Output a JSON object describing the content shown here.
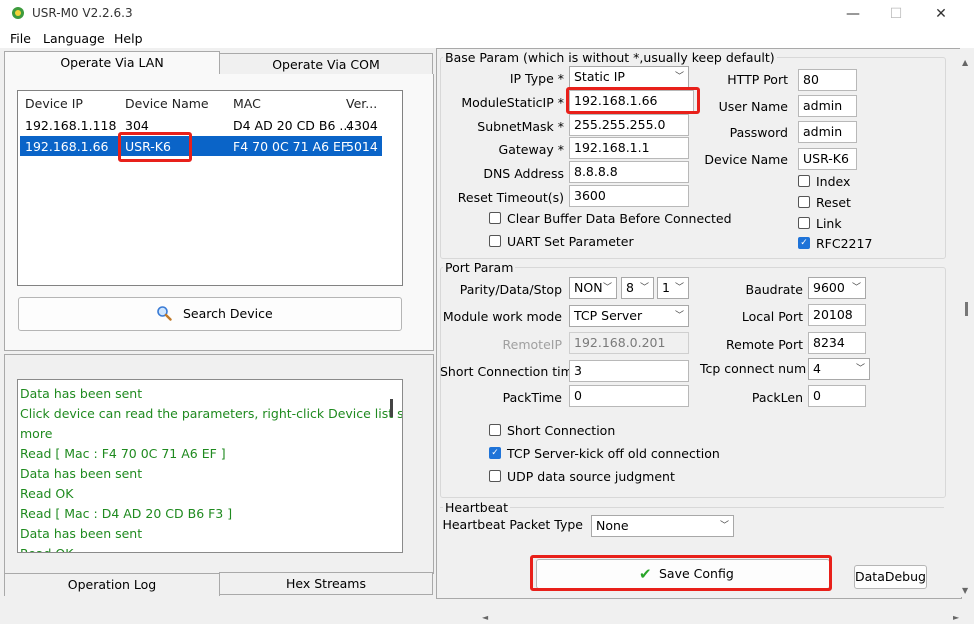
{
  "window": {
    "title": "USR-M0 V2.2.6.3",
    "controls": [
      "—",
      "☐",
      "✕"
    ]
  },
  "menu": [
    "File",
    "Language",
    "Help"
  ],
  "left_tabs": {
    "lan": "Operate Via LAN",
    "com": "Operate Via COM"
  },
  "device_table": {
    "headers": [
      "Device IP",
      "Device Name",
      "MAC",
      "Ver..."
    ],
    "rows": [
      [
        "192.168.1.118",
        "304",
        "D4 AD 20 CD B6 ...",
        "4304"
      ],
      [
        "192.168.1.66",
        "USR-K6",
        "F4 70 0C 71 A6 EF",
        "5014"
      ]
    ]
  },
  "search_button": "Search Device",
  "log": [
    " Data has been sent",
    "Click device can read the parameters, right-click Device list show",
    "more",
    "Read [ Mac : F4 70 0C 71 A6 EF ]",
    " Data has been sent",
    "Read OK",
    "Read [ Mac : D4 AD 20 CD B6 F3 ]",
    " Data has been sent",
    "Read OK"
  ],
  "bottom_tabs": {
    "log": "Operation Log",
    "hex": "Hex Streams"
  },
  "base_param": {
    "title": "Base Param (which is without *,usually keep default)",
    "ip_type_label": "IP Type *",
    "ip_type": "Static IP",
    "module_ip_label": "ModuleStaticIP *",
    "module_ip": "192.168.1.66",
    "subnet_label": "SubnetMask *",
    "subnet": "255.255.255.0",
    "gateway_label": "Gateway *",
    "gateway": "192.168.1.1",
    "dns_label": "DNS Address",
    "dns": "8.8.8.8",
    "reset_timeout_label": "Reset Timeout(s)",
    "reset_timeout": "3600",
    "clear_buffer": "Clear Buffer Data Before Connected",
    "uart_set": "UART Set Parameter",
    "http_port_label": "HTTP Port",
    "http_port": "80",
    "user_name_label": "User Name",
    "user_name": "admin",
    "password_label": "Password",
    "password": "admin",
    "device_name_label": "Device Name",
    "device_name": "USR-K6",
    "index": "Index",
    "reset": "Reset",
    "link": "Link",
    "rfc2217": "RFC2217"
  },
  "port_param": {
    "title": "Port Param",
    "parity_label": "Parity/Data/Stop",
    "parity": "NON",
    "data_bits": "8",
    "stop_bits": "1",
    "work_mode_label": "Module work mode",
    "work_mode": "TCP Server",
    "remote_ip_label": "RemoteIP",
    "remote_ip": "192.168.0.201",
    "short_conn_time_label": "Short Connection time",
    "short_conn_time": "3",
    "pack_time_label": "PackTime",
    "pack_time": "0",
    "baudrate_label": "Baudrate",
    "baudrate": "9600",
    "local_port_label": "Local Port",
    "local_port": "20108",
    "remote_port_label": "Remote Port",
    "remote_port": "8234",
    "tcp_connect_num_label": "Tcp connect num",
    "tcp_connect_num": "4",
    "pack_len_label": "PackLen",
    "pack_len": "0",
    "short_connection": "Short Connection",
    "kick_off": "TCP Server-kick off old connection",
    "udp_judgment": "UDP data source judgment"
  },
  "heartbeat": {
    "title": "Heartbeat",
    "type_label": "Heartbeat Packet Type",
    "type": "None"
  },
  "buttons": {
    "save_config": "Save Config",
    "data_debug": "DataDebug"
  },
  "colors": {
    "selection": "#0a64c8",
    "highlight_box": "#e8201a",
    "log_text": "#1f8a1f",
    "check_blue": "#1e73d8"
  }
}
